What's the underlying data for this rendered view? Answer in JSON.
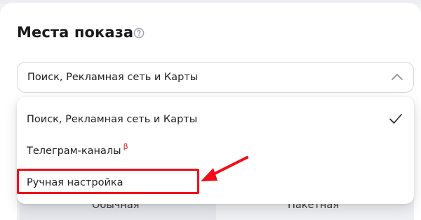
{
  "section": {
    "title": "Места показа"
  },
  "select": {
    "value": "Поиск, Рекламная сеть и Карты"
  },
  "dropdown": {
    "options": [
      {
        "label": "Поиск, Рекламная сеть и Карты",
        "selected": true
      },
      {
        "label": "Телеграм-каналы",
        "badge": "β",
        "selected": false
      },
      {
        "label": "Ручная настройка",
        "selected": false
      }
    ]
  },
  "segmented": {
    "options": [
      "Обычная",
      "Пакетная"
    ],
    "active_index": 0
  },
  "icons": {
    "help": "help-circle-icon",
    "chevron": "chevron-up-icon",
    "check": "check-icon"
  },
  "colors": {
    "accent_red": "#f20d18",
    "beta_red": "#e0262a"
  }
}
